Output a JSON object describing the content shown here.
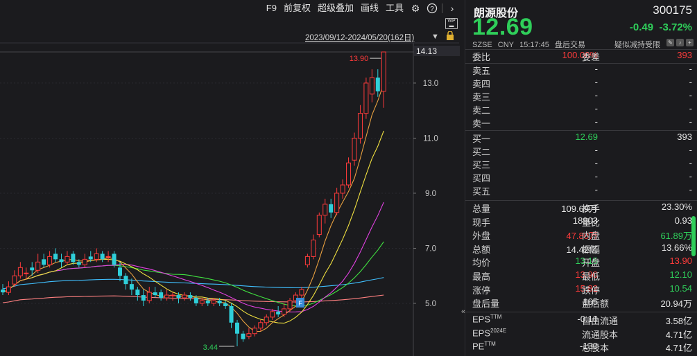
{
  "toolbar": {
    "items": [
      "F9",
      "前复权",
      "超级叠加",
      "画线",
      "工具"
    ],
    "range": "2023/09/12-2024/05/20(162日)",
    "wp_label": "WP"
  },
  "colors": {
    "up": "#ff3b3b",
    "down": "#2fcfd9",
    "green": "#2fcf5a",
    "ma5": "#ffffff",
    "ma10": "#f0e040",
    "ma20": "#e040e0",
    "ma30": "#40e040",
    "ma60": "#40c0ff",
    "ma120": "#ff8080"
  },
  "chart_data": {
    "type": "candlestick",
    "title": "",
    "xlabel": "",
    "ylabel": "",
    "ylim": [
      3.44,
      14.13
    ],
    "yticks": [
      5.0,
      7.0,
      9.0,
      11.0,
      13.0
    ],
    "top_label": "14.13",
    "max_annotation": "13.90",
    "min_annotation": "3.44",
    "candles": [
      [
        5.5,
        5.4,
        5.7,
        5.3
      ],
      [
        5.4,
        5.6,
        5.8,
        5.3
      ],
      [
        5.7,
        6.0,
        6.2,
        5.6
      ],
      [
        6.0,
        6.3,
        6.5,
        5.9
      ],
      [
        6.1,
        6.1,
        6.3,
        5.9
      ],
      [
        6.3,
        6.2,
        6.5,
        6.0
      ],
      [
        6.2,
        6.5,
        6.8,
        6.1
      ],
      [
        6.6,
        6.4,
        6.8,
        6.3
      ],
      [
        6.4,
        6.7,
        6.9,
        6.3
      ],
      [
        6.8,
        6.6,
        7.0,
        6.5
      ],
      [
        6.6,
        6.5,
        6.8,
        6.3
      ],
      [
        6.5,
        6.7,
        6.9,
        6.4
      ],
      [
        6.8,
        6.5,
        6.9,
        6.4
      ],
      [
        6.5,
        6.4,
        6.6,
        6.3
      ],
      [
        6.4,
        6.6,
        6.8,
        6.3
      ],
      [
        6.7,
        6.6,
        6.9,
        6.5
      ],
      [
        6.6,
        6.8,
        7.0,
        6.5
      ],
      [
        6.8,
        6.6,
        6.9,
        6.5
      ],
      [
        6.7,
        6.7,
        6.9,
        6.5
      ],
      [
        6.8,
        6.4,
        6.9,
        6.3
      ],
      [
        6.3,
        6.0,
        6.5,
        5.8
      ],
      [
        6.0,
        5.7,
        6.1,
        5.5
      ],
      [
        5.7,
        5.5,
        5.9,
        5.3
      ],
      [
        5.5,
        5.3,
        5.6,
        5.1
      ],
      [
        5.3,
        5.1,
        5.5,
        4.9
      ],
      [
        5.1,
        5.4,
        5.6,
        5.0
      ],
      [
        5.4,
        5.3,
        5.6,
        5.2
      ],
      [
        5.4,
        5.2,
        5.5,
        5.1
      ],
      [
        5.2,
        5.3,
        5.5,
        5.1
      ],
      [
        5.3,
        5.3,
        5.4,
        5.1
      ],
      [
        5.3,
        5.2,
        5.4,
        5.0
      ],
      [
        5.2,
        5.3,
        5.4,
        5.1
      ],
      [
        5.3,
        5.2,
        5.4,
        5.1
      ],
      [
        5.2,
        5.0,
        5.3,
        4.9
      ],
      [
        5.0,
        5.1,
        5.2,
        4.9
      ],
      [
        5.1,
        5.0,
        5.2,
        4.9
      ],
      [
        5.0,
        5.1,
        5.2,
        4.9
      ],
      [
        5.1,
        5.0,
        5.2,
        4.9
      ],
      [
        5.0,
        4.9,
        5.1,
        4.8
      ],
      [
        4.9,
        4.3,
        5.0,
        4.1
      ],
      [
        4.3,
        3.9,
        4.4,
        3.44
      ],
      [
        3.9,
        3.7,
        4.0,
        3.6
      ],
      [
        3.8,
        3.9,
        4.1,
        3.7
      ],
      [
        3.9,
        4.1,
        4.2,
        3.8
      ],
      [
        4.1,
        4.3,
        4.4,
        4.0
      ],
      [
        4.3,
        4.5,
        4.6,
        4.2
      ],
      [
        4.5,
        4.7,
        4.8,
        4.4
      ],
      [
        4.7,
        4.6,
        4.9,
        4.5
      ],
      [
        4.6,
        4.8,
        5.0,
        4.5
      ],
      [
        4.8,
        5.1,
        5.2,
        4.7
      ],
      [
        5.1,
        5.3,
        5.4,
        5.0
      ],
      [
        5.3,
        5.5,
        5.6,
        5.2
      ],
      [
        6.4,
        6.7,
        6.8,
        6.3
      ],
      [
        6.7,
        7.3,
        7.5,
        6.6
      ],
      [
        7.5,
        8.2,
        8.3,
        7.4
      ],
      [
        8.2,
        8.6,
        8.8,
        7.9
      ],
      [
        8.6,
        8.3,
        8.8,
        8.1
      ],
      [
        8.3,
        9.0,
        9.2,
        8.2
      ],
      [
        9.0,
        9.3,
        9.5,
        8.8
      ],
      [
        9.3,
        10.1,
        10.3,
        9.2
      ],
      [
        10.2,
        11.0,
        11.2,
        10.0
      ],
      [
        11.0,
        11.9,
        12.2,
        10.8
      ],
      [
        11.9,
        13.0,
        13.2,
        11.7
      ],
      [
        12.6,
        13.2,
        13.5,
        12.3
      ],
      [
        13.2,
        12.7,
        13.5,
        12.5
      ],
      [
        12.7,
        14.13,
        14.13,
        12.1
      ]
    ],
    "ma_lines": [
      "ma5",
      "ma10",
      "ma20",
      "ma30",
      "ma60",
      "ma120"
    ]
  },
  "panel": {
    "name": "朗源股份",
    "code": "300175",
    "price": "12.69",
    "change": "-0.49",
    "change_pct": "-3.72%",
    "market": "SZSE",
    "currency": "CNY",
    "time": "15:17:45",
    "session": "盘后交易",
    "notice": "疑似减持受限",
    "weibi_label": "委比",
    "weibi": "100.00%",
    "weicha_label": "委差",
    "weicha": "393",
    "asks": [
      {
        "label": "卖五",
        "price": "-",
        "vol": "-"
      },
      {
        "label": "卖四",
        "price": "-",
        "vol": "-"
      },
      {
        "label": "卖三",
        "price": "-",
        "vol": "-"
      },
      {
        "label": "卖二",
        "price": "-",
        "vol": "-"
      },
      {
        "label": "卖一",
        "price": "-",
        "vol": "-"
      }
    ],
    "bids": [
      {
        "label": "买一",
        "price": "12.69",
        "vol": "393"
      },
      {
        "label": "买二",
        "price": "-",
        "vol": "-"
      },
      {
        "label": "买三",
        "price": "-",
        "vol": "-"
      },
      {
        "label": "买四",
        "price": "-",
        "vol": "-"
      },
      {
        "label": "买五",
        "price": "-",
        "vol": "-"
      }
    ],
    "stats": [
      {
        "l1": "总量",
        "v1": "109.69万",
        "c1": "white",
        "l2": "换手",
        "v2": "23.30%",
        "c2": "white"
      },
      {
        "l1": "现手",
        "v1": "18903",
        "c1": "white",
        "l2": "量比",
        "v2": "0.93",
        "c2": "white"
      },
      {
        "l1": "外盘",
        "v1": "47.80万",
        "c1": "red",
        "l2": "内盘",
        "v2": "61.89万",
        "c2": "green"
      },
      {
        "l1": "总额",
        "v1": "14.42亿",
        "c1": "white",
        "l2": "振幅",
        "v2": "13.66%",
        "c2": "white"
      },
      {
        "l1": "均价",
        "v1": "13.15",
        "c1": "green",
        "l2": "开盘",
        "v2": "13.90",
        "c2": "red"
      },
      {
        "l1": "最高",
        "v1": "13.90",
        "c1": "red",
        "l2": "最低",
        "v2": "12.10",
        "c2": "green"
      },
      {
        "l1": "涨停",
        "v1": "15.82",
        "c1": "red",
        "l2": "跌停",
        "v2": "10.54",
        "c2": "green"
      },
      {
        "l1": "盘后量",
        "v1": "165",
        "c1": "white",
        "l2": "盘后额",
        "v2": "20.94万",
        "c2": "white"
      }
    ],
    "fund": [
      {
        "l1": "EPS",
        "s1": "TTM",
        "v1": "-0.10",
        "l2": "自由流通",
        "v2": "3.58亿"
      },
      {
        "l1": "EPS",
        "s1": "2024E",
        "v1": "",
        "l2": "流通股本",
        "v2": "4.71亿"
      },
      {
        "l1": "PE",
        "s1": "TTM",
        "v1": "-130",
        "l2": "总股本",
        "v2": "4.71亿"
      }
    ]
  }
}
